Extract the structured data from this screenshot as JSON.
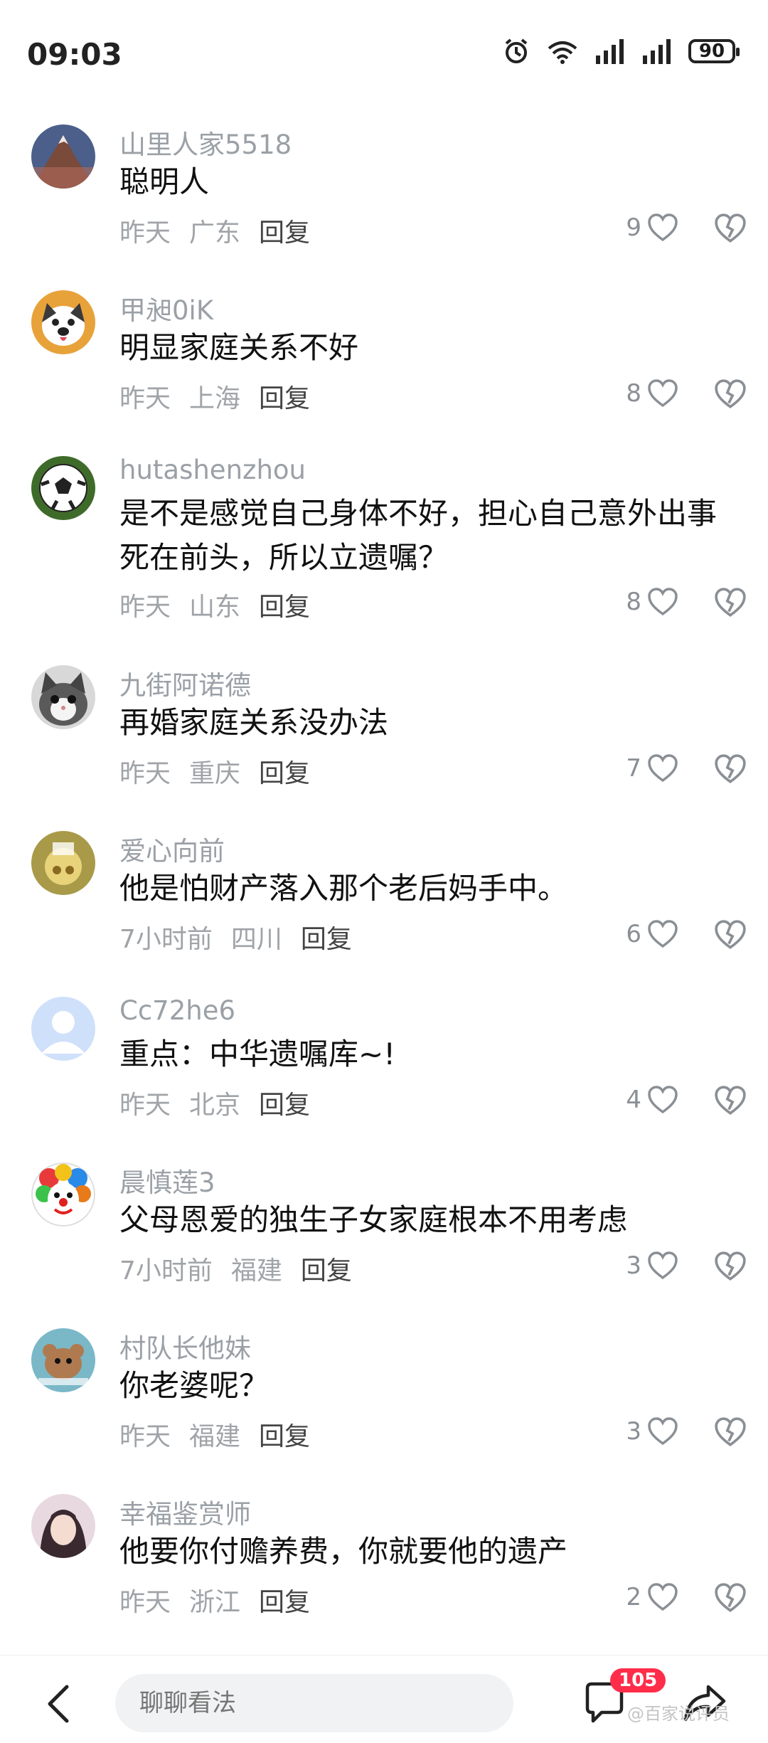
{
  "status_bar": {
    "time": "09:03",
    "battery": "90"
  },
  "comments": [
    {
      "user": "山里人家5518",
      "text": "聪明人",
      "time": "昨天",
      "location": "广东",
      "reply": "回复",
      "likes": "9"
    },
    {
      "user": "甲昶0iK",
      "text": "明显家庭关系不好",
      "time": "昨天",
      "location": "上海",
      "reply": "回复",
      "likes": "8"
    },
    {
      "user": "hutashenzhou",
      "text": "是不是感觉自己身体不好，担心自己意外出事死在前头，所以立遗嘱？",
      "time": "昨天",
      "location": "山东",
      "reply": "回复",
      "likes": "8"
    },
    {
      "user": "九街阿诺德",
      "text": "再婚家庭关系没办法",
      "time": "昨天",
      "location": "重庆",
      "reply": "回复",
      "likes": "7"
    },
    {
      "user": "爱心向前",
      "text": "他是怕财产落入那个老后妈手中。",
      "time": "7小时前",
      "location": "四川",
      "reply": "回复",
      "likes": "6"
    },
    {
      "user": "Cc72he6",
      "text": "重点：中华遗嘱库~!",
      "time": "昨天",
      "location": "北京",
      "reply": "回复",
      "likes": "4"
    },
    {
      "user": "晨慎莲3",
      "text": "父母恩爱的独生子女家庭根本不用考虑",
      "time": "7小时前",
      "location": "福建",
      "reply": "回复",
      "likes": "3"
    },
    {
      "user": "村队长他妹",
      "text": "你老婆呢？",
      "time": "昨天",
      "location": "福建",
      "reply": "回复",
      "likes": "3"
    },
    {
      "user": "幸福鉴赏师",
      "text": "他要你付赡养费，你就要他的遗产",
      "time": "昨天",
      "location": "浙江",
      "reply": "回复",
      "likes": "2"
    }
  ],
  "bottom_bar": {
    "input_placeholder": "聊聊看法",
    "comment_count": "105",
    "watermark": "@百家说评员"
  },
  "colors": {
    "badge": "#ff2d4a",
    "username": "#9aa0a6"
  }
}
